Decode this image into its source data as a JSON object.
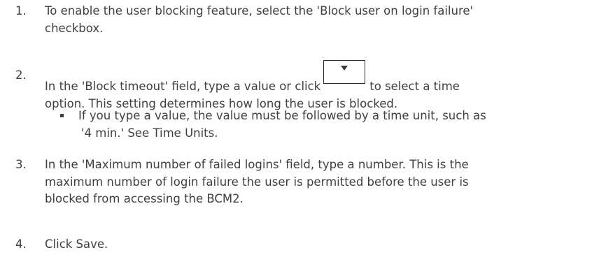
{
  "steps": [
    {
      "number": "1.",
      "lines": [
        "To enable the user blocking feature, select the 'Block user on login failure'",
        "checkbox."
      ]
    },
    {
      "number": "2.",
      "line1_before": "In the 'Block timeout' field, type a value or click",
      "line1_after": "to select a time",
      "line2": "option. This setting determines how long the user is blocked.",
      "button_icon": "dropdown-arrow-icon",
      "bullet": {
        "lines": [
          "If you type a value, the value must be followed by a time unit, such as",
          "'4 min.' See Time Units."
        ]
      }
    },
    {
      "number": "3.",
      "lines": [
        "In the 'Maximum number of failed logins' field, type a number. This is the",
        "maximum number of login failure the user is permitted before the user is",
        "blocked from accessing the BCM2."
      ]
    },
    {
      "number": "4.",
      "lines": [
        "Click Save."
      ]
    }
  ]
}
